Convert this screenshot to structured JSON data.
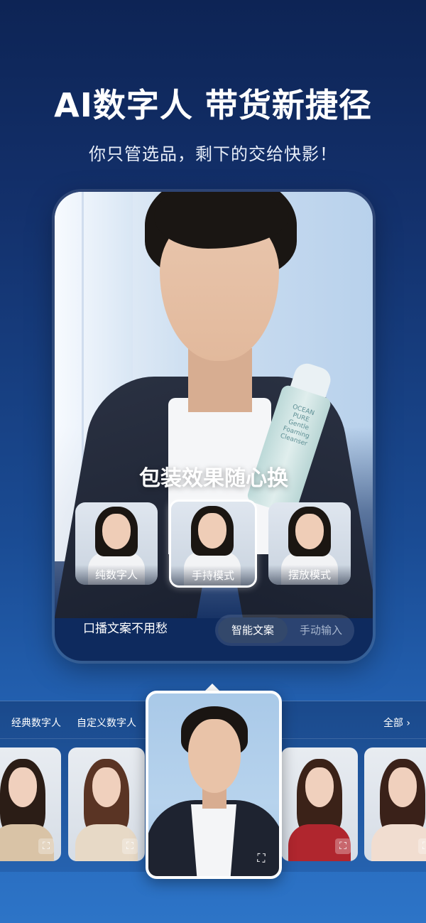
{
  "hero": {
    "title": "AI数字人 带货新捷径",
    "subtitle": "你只管选品，剩下的交给快影！"
  },
  "card": {
    "product_text": "OCEAN PURE Gentle Foaming Cleanser",
    "caption": "包装效果随心换",
    "modes": [
      {
        "label": "纯数字人",
        "selected": false
      },
      {
        "label": "手持模式",
        "selected": true
      },
      {
        "label": "摆放模式",
        "selected": false
      }
    ],
    "script_label": "口播文案不用愁",
    "toggle": {
      "active": "智能文案",
      "inactive": "手动输入"
    }
  },
  "strip": {
    "tabs": [
      "经典数字人",
      "自定义数字人"
    ],
    "all_label": "全部 ›"
  },
  "colors": {
    "bg_top": "#0d2455",
    "bg_bottom": "#2d74c7",
    "card_bg": "#0e2a5e",
    "toggle_active": "#33486b"
  },
  "icons": {
    "expand": "expand-icon",
    "chevron": "chevron-right-icon"
  }
}
